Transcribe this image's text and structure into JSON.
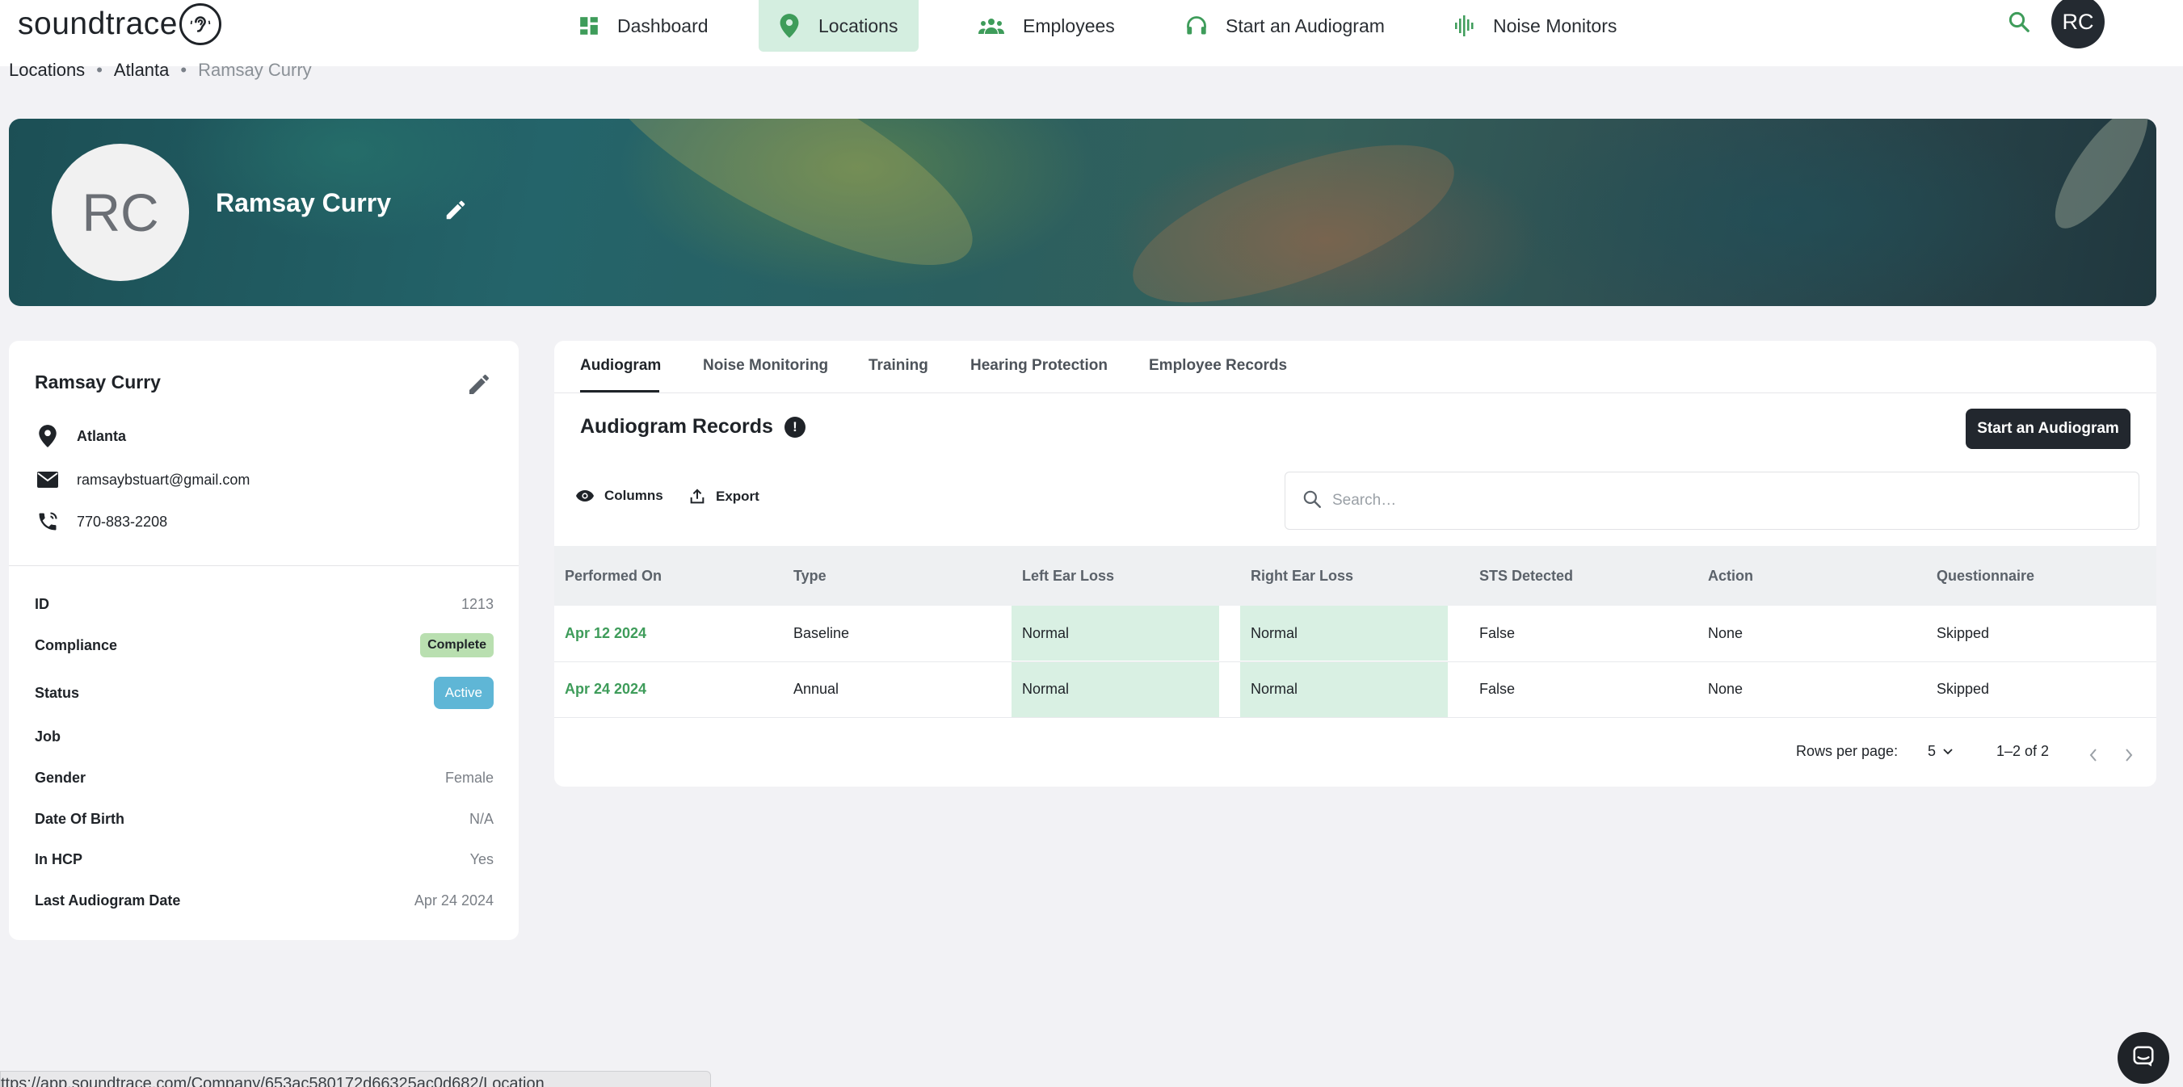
{
  "brand": {
    "logo_text": "soundtrace"
  },
  "nav": {
    "items": [
      {
        "label": "Dashboard",
        "icon": "dashboard-grid-icon"
      },
      {
        "label": "Locations",
        "icon": "location-pin-icon",
        "active": true
      },
      {
        "label": "Employees",
        "icon": "people-group-icon"
      },
      {
        "label": "Start an Audiogram",
        "icon": "headphones-icon"
      },
      {
        "label": "Noise Monitors",
        "icon": "sound-wave-icon"
      }
    ],
    "avatar_initials": "RC"
  },
  "breadcrumb": [
    "Locations",
    "Atlanta",
    "Ramsay Curry"
  ],
  "banner": {
    "avatar_initials": "RC",
    "name": "Ramsay Curry"
  },
  "profile": {
    "name": "Ramsay Curry",
    "location": "Atlanta",
    "email": "ramsaybstuart@gmail.com",
    "phone": "770-883-2208",
    "fields": [
      {
        "label": "ID",
        "value": "1213"
      },
      {
        "label": "Compliance",
        "value": "Complete"
      },
      {
        "label": "Status",
        "value": "Active"
      },
      {
        "label": "Job",
        "value": ""
      },
      {
        "label": "Gender",
        "value": "Female"
      },
      {
        "label": "Date Of Birth",
        "value": "N/A"
      },
      {
        "label": "In HCP",
        "value": "Yes"
      },
      {
        "label": "Last Audiogram Date",
        "value": "Apr 24 2024"
      }
    ]
  },
  "tabs": [
    "Audiogram",
    "Noise Monitoring",
    "Training",
    "Hearing Protection",
    "Employee Records"
  ],
  "records": {
    "title": "Audiogram Records",
    "info_glyph": "!",
    "start_button": "Start an Audiogram",
    "columns_label": "Columns",
    "export_label": "Export",
    "search_placeholder": "Search…",
    "headers": [
      "Performed On",
      "Type",
      "Left Ear Loss",
      "Right Ear Loss",
      "STS Detected",
      "Action",
      "Questionnaire"
    ],
    "rows": [
      [
        "Apr 12 2024",
        "Baseline",
        "Normal",
        "Normal",
        "False",
        "None",
        "Skipped"
      ],
      [
        "Apr 24 2024",
        "Annual",
        "Normal",
        "Normal",
        "False",
        "None",
        "Skipped"
      ]
    ],
    "rows_per_page_label": "Rows per page:",
    "rows_per_page_value": "5",
    "range": "1–2 of 2"
  },
  "status_url": "ttps://app.soundtrace.com/Company/653ac580172d66325ac0d682/Location",
  "colors": {
    "accent_green": "#3e9c5a",
    "dark": "#22272e",
    "active_badge": "#5fb6d6",
    "complete_badge": "#b9dfb0",
    "normal_cell": "#d9f0e3"
  }
}
